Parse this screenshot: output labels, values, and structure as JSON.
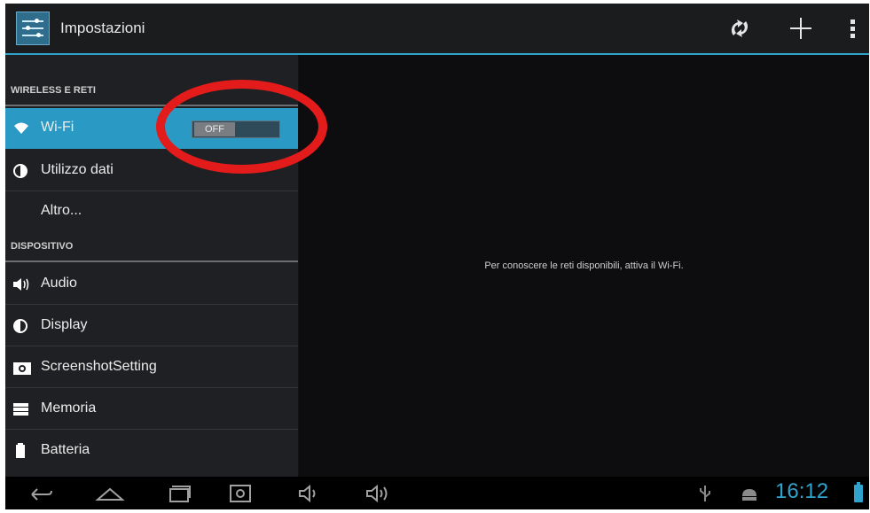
{
  "actionbar": {
    "title": "Impostazioni",
    "icons": [
      "settings-app-icon",
      "sync-icon",
      "add-icon",
      "overflow-menu-icon"
    ]
  },
  "sidebar": {
    "sections": [
      {
        "label": "WIRELESS E RETI"
      },
      {
        "label": "DISPOSITIVO"
      }
    ],
    "items": [
      {
        "label": "Wi-Fi",
        "icon": "wifi-icon",
        "selected": true,
        "toggle": "OFF"
      },
      {
        "label": "Utilizzo dati",
        "icon": "data-usage-icon"
      },
      {
        "label": "Altro...",
        "icon": ""
      },
      {
        "label": "Audio",
        "icon": "speaker-icon"
      },
      {
        "label": "Display",
        "icon": "brightness-icon"
      },
      {
        "label": "ScreenshotSetting",
        "icon": "camera-icon"
      },
      {
        "label": "Memoria",
        "icon": "storage-icon"
      },
      {
        "label": "Batteria",
        "icon": "battery-icon"
      }
    ]
  },
  "content": {
    "message": "Per conoscere le reti disponibili, attiva il Wi-Fi."
  },
  "statusbar": {
    "time": "16:12"
  },
  "colors": {
    "accent": "#2fa3cc",
    "annotation": "#e31b1b",
    "background": "#111214"
  }
}
